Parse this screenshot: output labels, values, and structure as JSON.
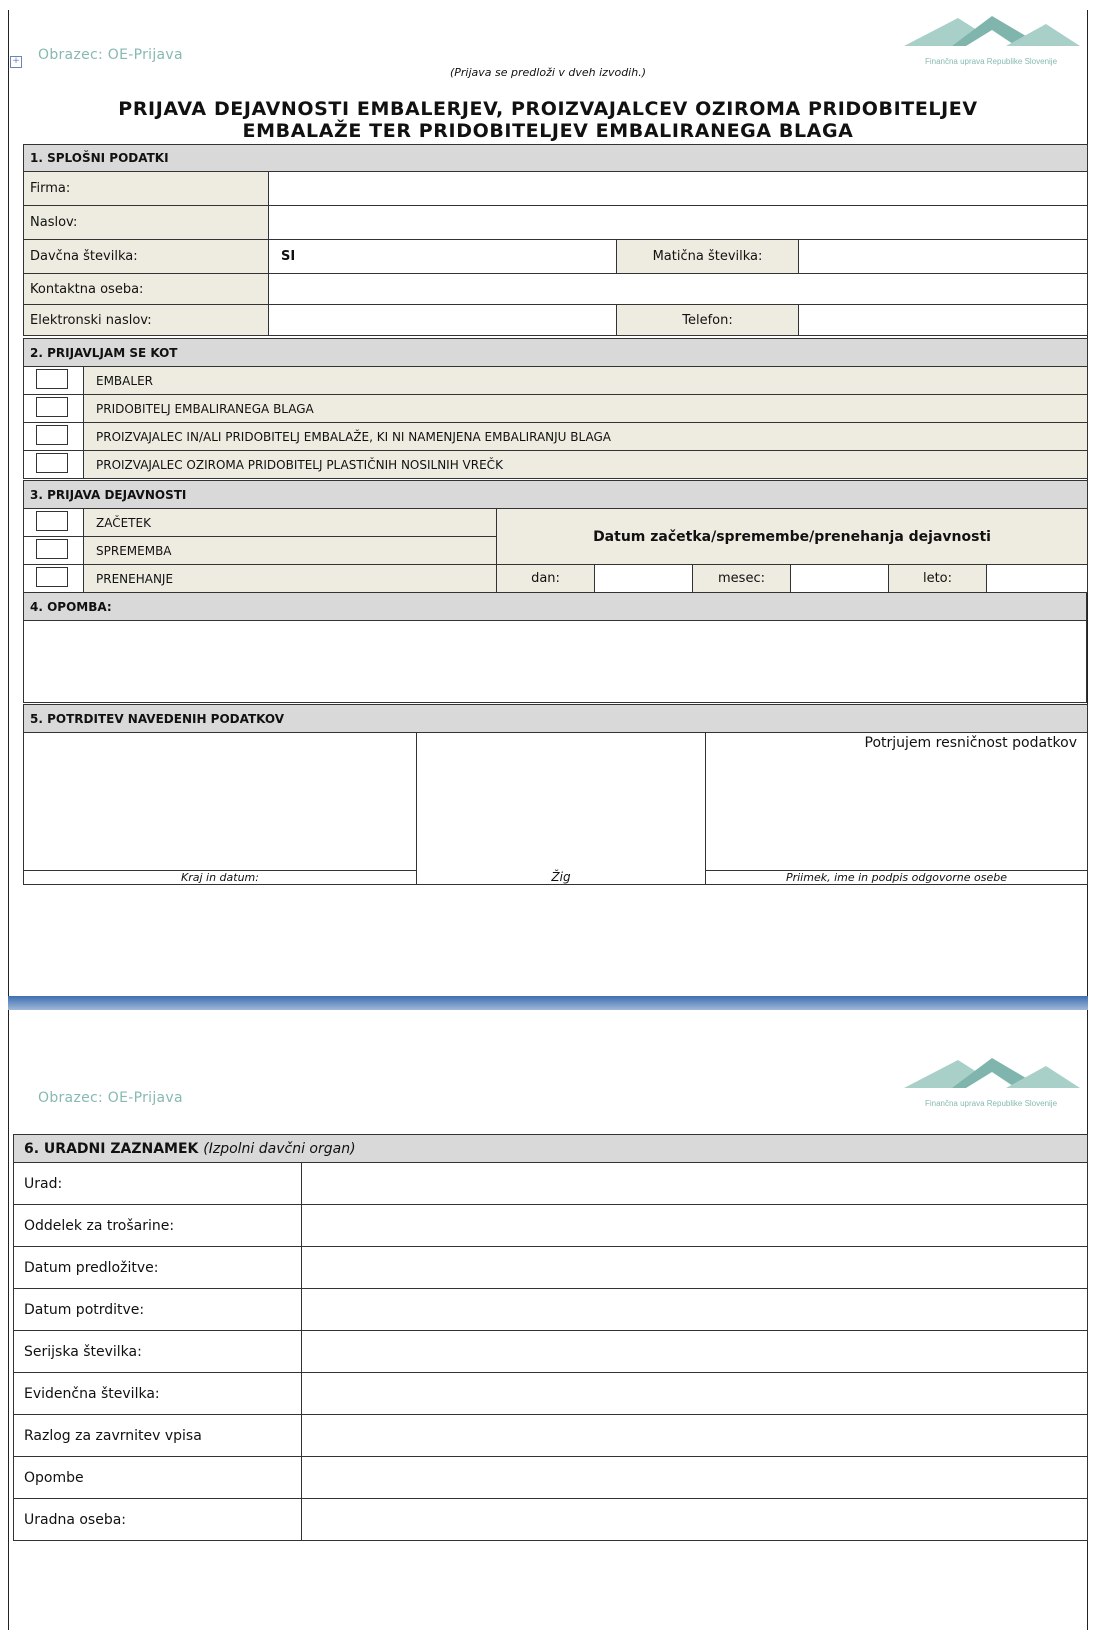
{
  "page1": {
    "form_label": "Obrazec: OE-Prijava",
    "logo_text": "Finančna uprava Republike Slovenije",
    "note": "(Prijava se predloži v dveh izvodih.)",
    "title_line1": "PRIJAVA DEJAVNOSTI EMBALERJEV, PROIZVAJALCEV OZIROMA PRIDOBITELJEV",
    "title_line2": "EMBALAŽE TER PRIDOBITELJEV EMBALIRANEGA BLAGA",
    "s1": {
      "heading": "1. SPLOŠNI PODATKI",
      "firma": "Firma:",
      "naslov": "Naslov:",
      "davcna": "Davčna številka:",
      "davcna_value": "SI",
      "maticna": "Matična številka:",
      "kontakt": "Kontaktna oseba:",
      "email": "Elektronski naslov:",
      "telefon": "Telefon:"
    },
    "s2": {
      "heading": "2. PRIJAVLJAM SE KOT",
      "options": [
        "EMBALER",
        "PRIDOBITELJ EMBALIRANEGA BLAGA",
        "PROIZVAJALEC IN/ALI PRIDOBITELJ EMBALAŽE, KI NI NAMENJENA EMBALIRANJU BLAGA",
        "PROIZVAJALEC OZIROMA PRIDOBITELJ PLASTIČNIH NOSILNIH VREČK"
      ]
    },
    "s3": {
      "heading": "3. PRIJAVA DEJAVNOSTI",
      "options": [
        "ZAČETEK",
        "SPREMEMBA",
        "PRENEHANJE"
      ],
      "date_title": "Datum začetka/spremembe/prenehanja dejavnosti",
      "dan": "dan:",
      "mesec": "mesec:",
      "leto": "leto:"
    },
    "s4": {
      "heading": "4. OPOMBA:"
    },
    "s5": {
      "heading": "5. POTRDITEV NAVEDENIH PODATKOV",
      "confirm": "Potrjujem resničnost podatkov",
      "place_date": "Kraj in datum:",
      "stamp": "Žig",
      "signature": "Priimek, ime in podpis odgovorne osebe"
    }
  },
  "page2": {
    "form_label": "Obrazec: OE-Prijava",
    "logo_text": "Finančna uprava Republike Slovenije",
    "s6": {
      "heading": "6. URADNI ZAZNAMEK",
      "heading_note": "(Izpolni davčni organ)",
      "rows": [
        "Urad:",
        "Oddelek za trošarine:",
        "Datum predložitve:",
        "Datum potrditve:",
        "Serijska številka:",
        "Evidenčna številka:",
        "Razlog za zavrnitev vpisa",
        "Opombe",
        "Uradna oseba:"
      ]
    }
  },
  "colors": {
    "section_bg": "#d9d9d9",
    "label_bg": "#eeece1",
    "header_teal": "#86b9b1",
    "page_break": "#3f6fb0"
  }
}
